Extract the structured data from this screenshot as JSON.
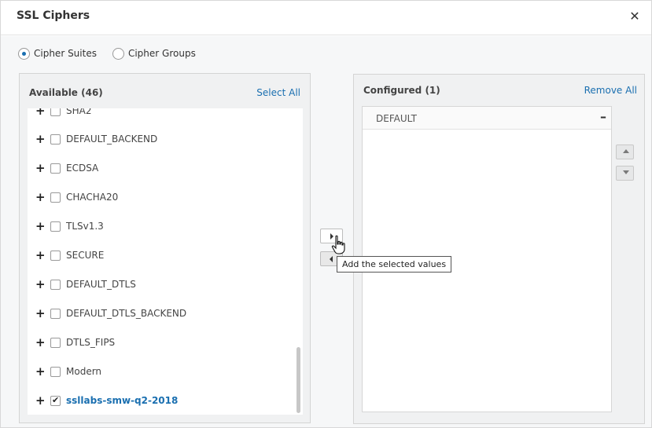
{
  "dialog": {
    "title": "SSL Ciphers",
    "close_icon": "close-icon"
  },
  "mode": {
    "options": [
      {
        "label": "Cipher Suites",
        "checked": true
      },
      {
        "label": "Cipher Groups",
        "checked": false
      }
    ]
  },
  "available": {
    "title": "Available (46)",
    "select_all": "Select All",
    "items": [
      {
        "label": "SHA2",
        "checked": false,
        "selected": false
      },
      {
        "label": "DEFAULT_BACKEND",
        "checked": false,
        "selected": false
      },
      {
        "label": "ECDSA",
        "checked": false,
        "selected": false
      },
      {
        "label": "CHACHA20",
        "checked": false,
        "selected": false
      },
      {
        "label": "TLSv1.3",
        "checked": false,
        "selected": false
      },
      {
        "label": "SECURE",
        "checked": false,
        "selected": false
      },
      {
        "label": "DEFAULT_DTLS",
        "checked": false,
        "selected": false
      },
      {
        "label": "DEFAULT_DTLS_BACKEND",
        "checked": false,
        "selected": false
      },
      {
        "label": "DTLS_FIPS",
        "checked": false,
        "selected": false
      },
      {
        "label": "Modern",
        "checked": false,
        "selected": false
      },
      {
        "label": "ssllabs-smw-q2-2018",
        "checked": true,
        "selected": true
      }
    ]
  },
  "configured": {
    "title": "Configured (1)",
    "remove_all": "Remove All",
    "items": [
      {
        "label": "DEFAULT"
      }
    ]
  },
  "transfer": {
    "tooltip": "Add the selected values"
  },
  "colors": {
    "accent": "#1a6fb0",
    "panel_bg": "#f0f1f2"
  }
}
